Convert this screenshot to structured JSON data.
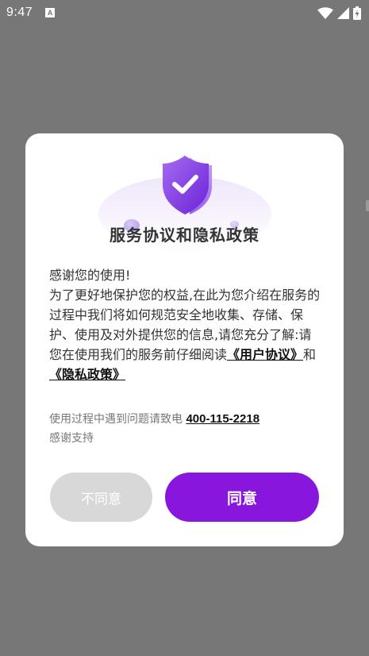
{
  "status_bar": {
    "time": "9:47",
    "notification_icon_letter": "A",
    "icons": [
      "wifi-icon",
      "signal-icon",
      "battery-charging-icon"
    ]
  },
  "dialog": {
    "title": "服务协议和隐私政策",
    "greeting": "感谢您的使用!",
    "body_text": "为了更好地保护您的权益,在此为您介绍在服务的过程中我们将如何规范安全地收集、存储、保护、使用及对外提供您的信息,请您充分了解:请您在使用我们的服务前仔细阅读",
    "user_agreement_link": "《用户协议》",
    "conjunction": "和",
    "privacy_policy_link": "《隐私政策》",
    "contact_prefix": "使用过程中遇到问题请致电",
    "phone": "400-115-2218",
    "thanks": "感谢支持",
    "disagree_label": "不同意",
    "agree_label": "同意"
  },
  "colors": {
    "overlay": "#777777",
    "accent": "#8816dc",
    "disabled_button": "#d8d8d8"
  }
}
